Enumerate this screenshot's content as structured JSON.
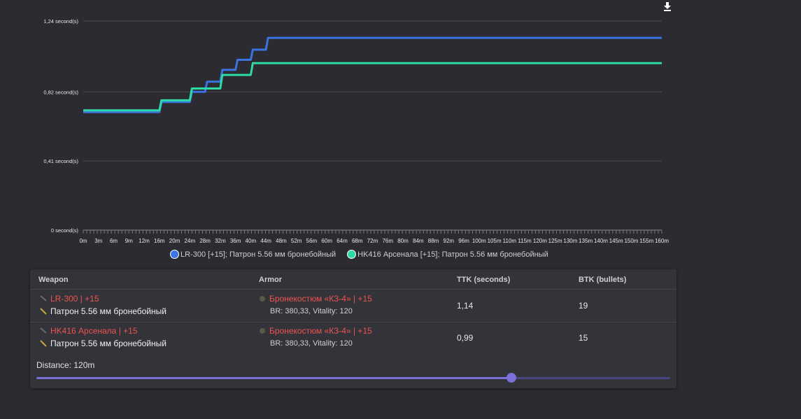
{
  "chart_data": {
    "type": "line",
    "y_ticks": [
      {
        "value": 0,
        "label": "0 second(s)"
      },
      {
        "value": 0.41,
        "label": "0,41 second(s)"
      },
      {
        "value": 0.82,
        "label": "0,82 second(s)"
      },
      {
        "value": 1.24,
        "label": "1,24 second(s)"
      }
    ],
    "ylim": [
      0,
      1.24
    ],
    "x_labels": [
      "0m",
      "3m",
      "6m",
      "9m",
      "12m",
      "16m",
      "20m",
      "24m",
      "28m",
      "32m",
      "36m",
      "40m",
      "44m",
      "48m",
      "52m",
      "56m",
      "60m",
      "64m",
      "68m",
      "72m",
      "76m",
      "80m",
      "84m",
      "88m",
      "92m",
      "96m",
      "100m",
      "105m",
      "110m",
      "115m",
      "120m",
      "125m",
      "130m",
      "135m",
      "140m",
      "145m",
      "150m",
      "155m",
      "160m"
    ],
    "series": [
      {
        "name": "LR-300 [+15]; Патрон 5.56 мм бронебойный",
        "color": "#3b73e0",
        "steps": [
          {
            "from": "0m",
            "to": "16m",
            "y": 0.7
          },
          {
            "from": "16m",
            "to": "24m",
            "y": 0.76
          },
          {
            "from": "24m",
            "to": "28m",
            "y": 0.82
          },
          {
            "from": "28m",
            "to": "32m",
            "y": 0.88
          },
          {
            "from": "32m",
            "to": "36m",
            "y": 0.95
          },
          {
            "from": "36m",
            "to": "40m",
            "y": 1.01
          },
          {
            "from": "40m",
            "to": "44m",
            "y": 1.07
          },
          {
            "from": "44m",
            "to": "160m",
            "y": 1.14
          }
        ]
      },
      {
        "name": "HK416 Арсенала [+15]; Патрон 5.56 мм бронебойный",
        "color": "#2fd9a6",
        "steps": [
          {
            "from": "0m",
            "to": "16m",
            "y": 0.71
          },
          {
            "from": "16m",
            "to": "24m",
            "y": 0.77
          },
          {
            "from": "24m",
            "to": "32m",
            "y": 0.84
          },
          {
            "from": "32m",
            "to": "40m",
            "y": 0.92
          },
          {
            "from": "40m",
            "to": "48m",
            "y": 0.99
          },
          {
            "from": "48m",
            "to": "160m",
            "y": 0.99
          }
        ]
      }
    ],
    "grid": true,
    "legend_position": "bottom"
  },
  "table": {
    "headers": {
      "weapon": "Weapon",
      "armor": "Armor",
      "ttk": "TTK (seconds)",
      "btk": "BTK (bullets)"
    },
    "rows": [
      {
        "weapon": "LR-300 | +15",
        "ammo": "Патрон 5.56 мм бронебойный",
        "armor": "Бронекостюм «КЗ-4» | +15",
        "armor_stats": "BR: 380,33, Vitality: 120",
        "ttk": "1,14",
        "btk": "19"
      },
      {
        "weapon": "HK416 Арсенала | +15",
        "ammo": "Патрон 5.56 мм бронебойный",
        "armor": "Бронекостюм «КЗ-4» | +15",
        "armor_stats": "BR: 380,33, Vitality: 120",
        "ttk": "0,99",
        "btk": "15"
      }
    ]
  },
  "distance": {
    "label": "Distance: 120m",
    "value_fraction": 0.749
  },
  "colors": {
    "accent": "#7b6fd8",
    "red": "#ef5350"
  }
}
